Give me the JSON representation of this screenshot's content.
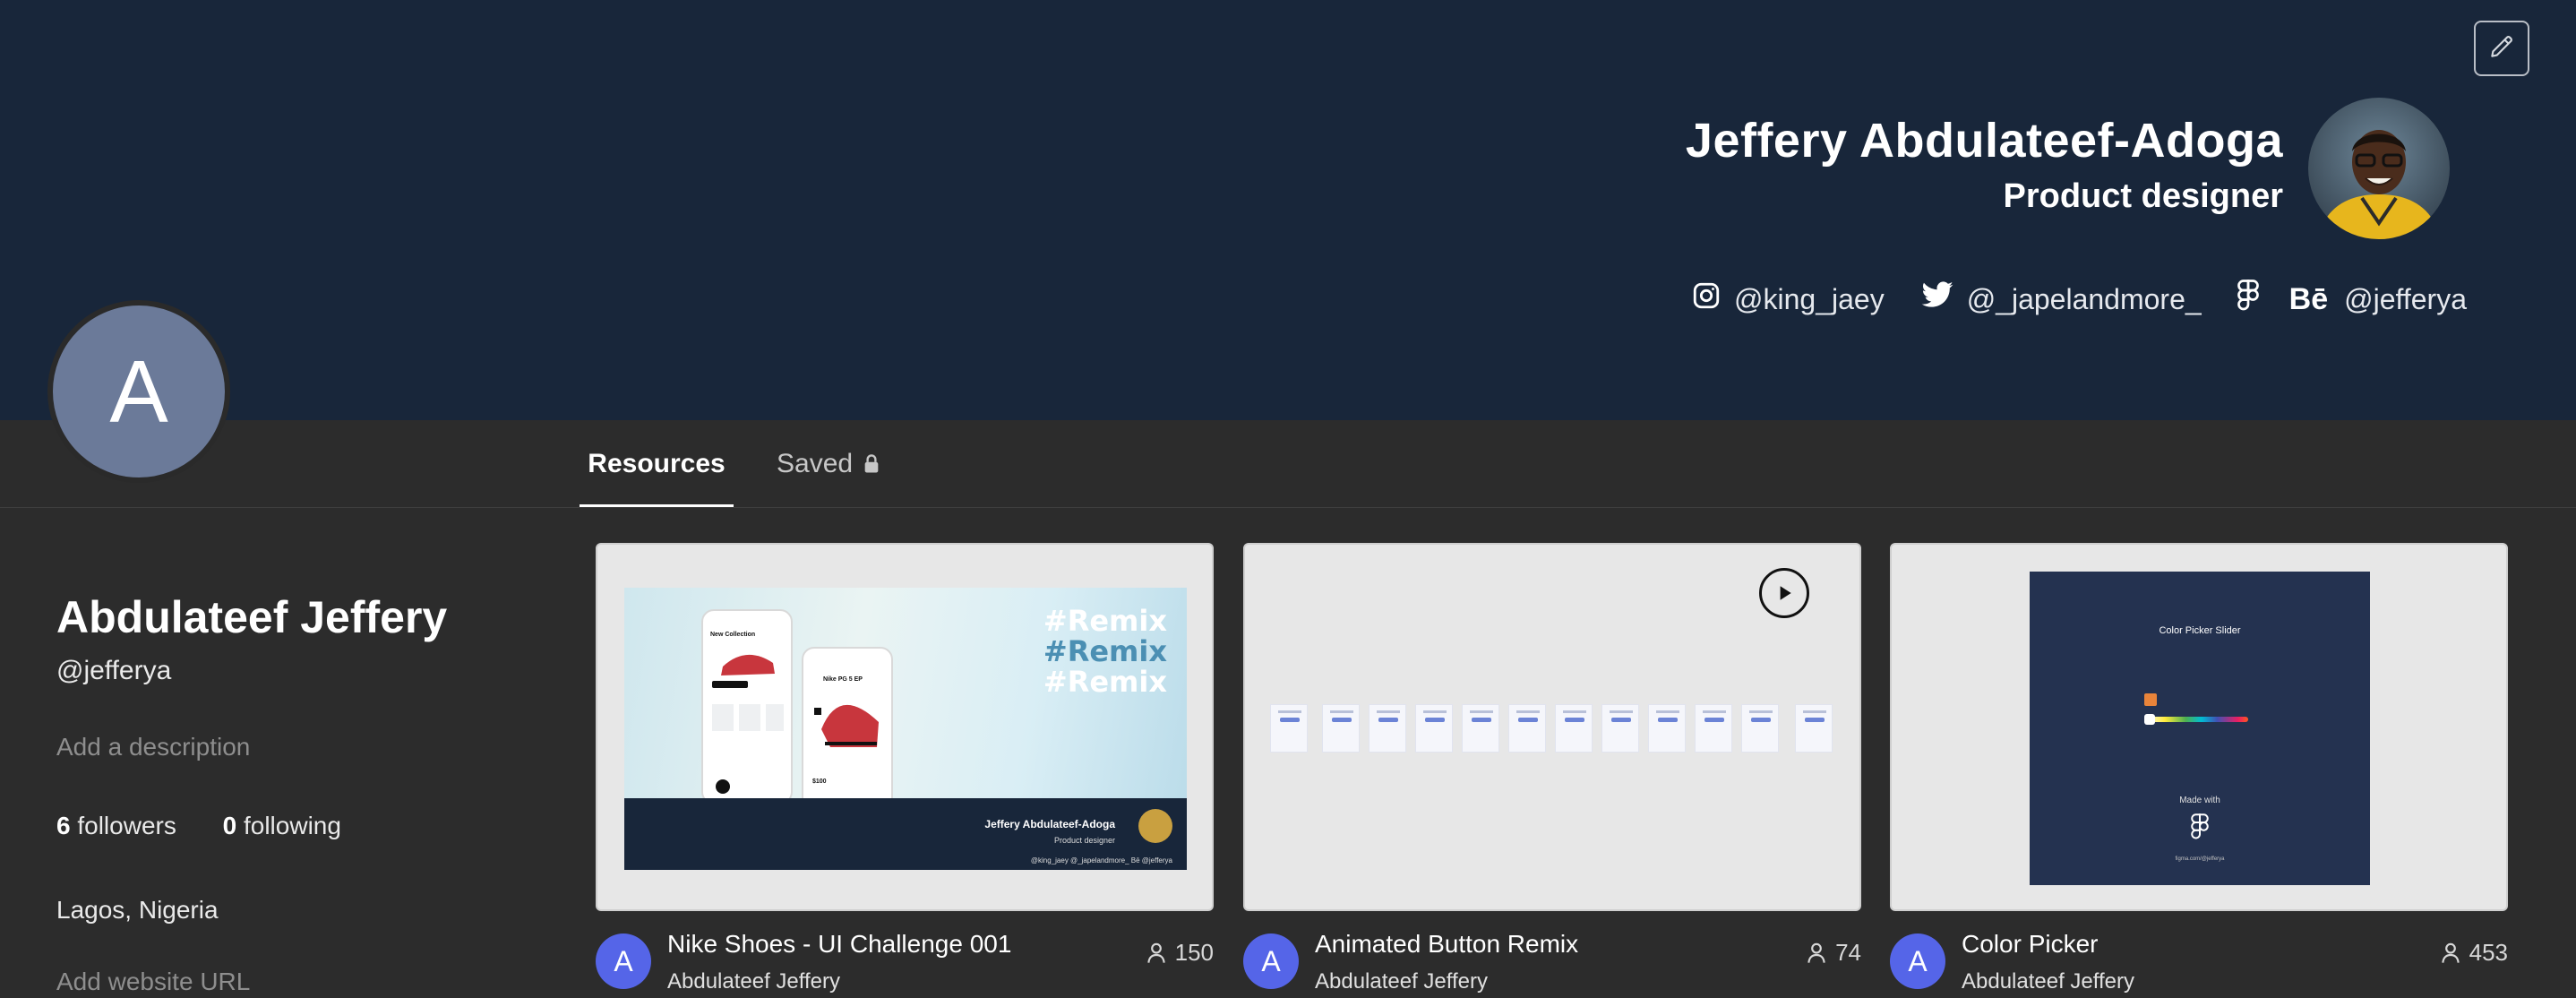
{
  "header": {
    "name": "Jeffery Abdulateef-Adoga",
    "role": "Product designer",
    "socials": {
      "instagram": "@king_jaey",
      "twitter": "@_japelandmore_",
      "behance_mark": "Bē",
      "behance": "@jefferya"
    }
  },
  "profile": {
    "avatar_letter": "A",
    "name": "Abdulateef Jeffery",
    "handle": "@jefferya",
    "description_placeholder": "Add a description",
    "followers_count": "6",
    "followers_label": "followers",
    "following_count": "0",
    "following_label": "following",
    "location": "Lagos, Nigeria",
    "website_placeholder": "Add website URL"
  },
  "tabs": [
    {
      "label": "Resources",
      "active": true
    },
    {
      "label": "Saved",
      "locked": true
    }
  ],
  "cards": [
    {
      "title": "Nike Shoes - UI Challenge 001",
      "author": "Abdulateef Jeffery",
      "avatar_letter": "A",
      "count": "150",
      "thumb": {
        "remix": "#Remix",
        "signature": "Jeffery Abdulateef-Adoga",
        "signature_role": "Product designer",
        "socials_line": "@king_jaey   @_japelandmore_   Bē @jefferya"
      }
    },
    {
      "title": "Animated Button Remix",
      "author": "Abdulateef Jeffery",
      "avatar_letter": "A",
      "count": "74",
      "thumb": {
        "icon": "play-icon"
      }
    },
    {
      "title": "Color Picker",
      "author": "Abdulateef Jeffery",
      "avatar_letter": "A",
      "count": "453",
      "thumb": {
        "title": "Color Picker Slider",
        "made_with": "Made with",
        "url": "figma.com/@jefferya"
      }
    }
  ],
  "colors": {
    "banner": "#18263a",
    "page_bg": "#2c2c2c",
    "avatar": "#6b7a99",
    "card_avatar": "#5565e8"
  }
}
